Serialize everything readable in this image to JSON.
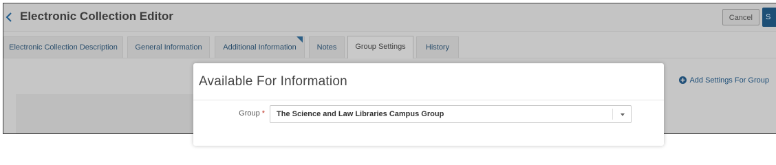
{
  "header": {
    "title": "Electronic Collection Editor",
    "cancel_label": "Cancel",
    "save_label": "S"
  },
  "tabs": [
    {
      "label": "Electronic Collection Description"
    },
    {
      "label": "General Information"
    },
    {
      "label": "Additional Information"
    },
    {
      "label": "Notes"
    },
    {
      "label": "Group Settings",
      "active": true
    },
    {
      "label": "History"
    }
  ],
  "content": {
    "add_settings_label": "Add Settings For Group"
  },
  "modal": {
    "title": "Available For Information",
    "group_label": "Group",
    "required_marker": "*",
    "group_value": "The Science and Law Libraries Campus Group"
  },
  "colors": {
    "accent": "#1d4f76",
    "link": "#2a4e6c",
    "required": "#c0392b"
  },
  "icons": [
    "back-chevron-icon",
    "plus-circle-icon",
    "caret-down-icon"
  ]
}
